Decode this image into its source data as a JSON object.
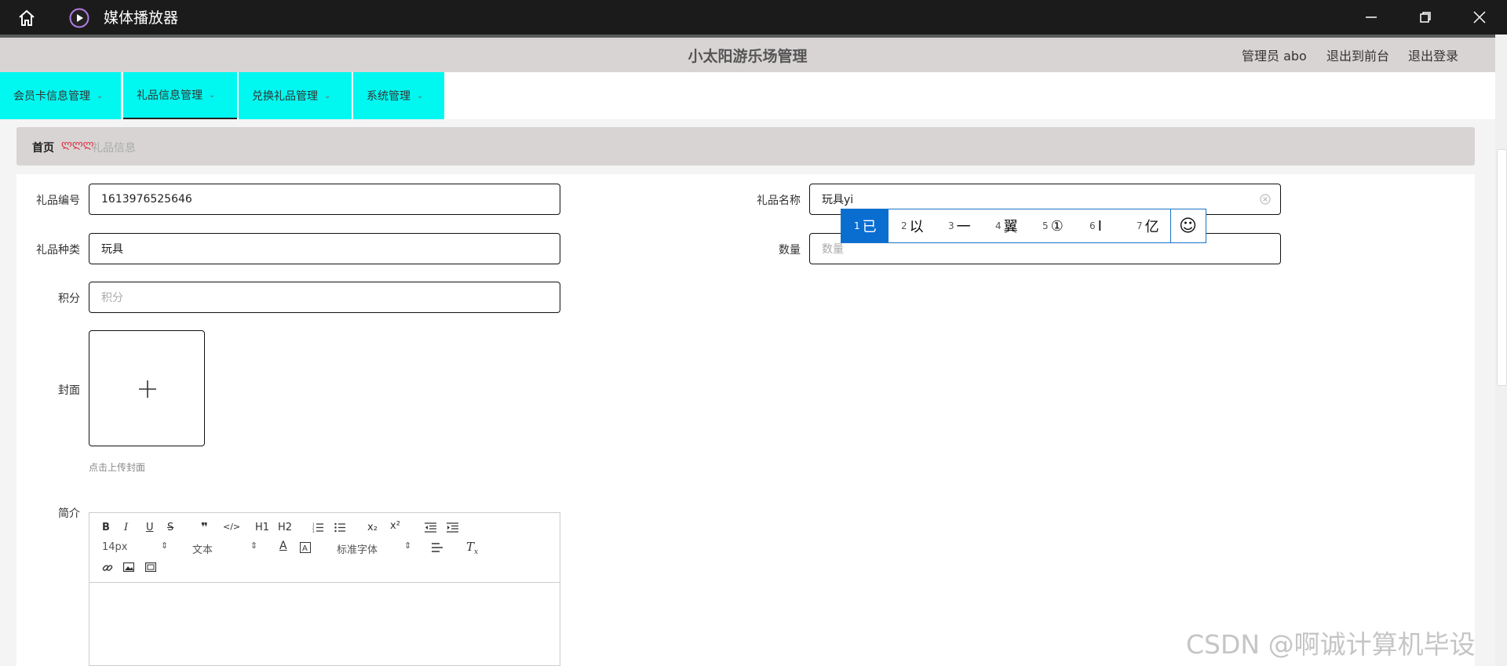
{
  "window": {
    "title": "媒体播放器",
    "controls": [
      "minimize-icon",
      "restore-icon",
      "close-icon"
    ]
  },
  "header": {
    "title": "小太阳游乐场管理",
    "admin": "管理员 abo",
    "to_frontend": "退出到前台",
    "logout": "退出登录"
  },
  "nav": {
    "items": [
      {
        "label": "会员卡信息管理"
      },
      {
        "label": "礼品信息管理"
      },
      {
        "label": "兑换礼品管理"
      },
      {
        "label": "系统管理"
      }
    ],
    "chevron": "⌄"
  },
  "breadcrumb": {
    "home": "首页",
    "separator": "ლლლ",
    "current": "礼品信息"
  },
  "form": {
    "gift_no_label": "礼品编号",
    "gift_no_value": "1613976525646",
    "gift_name_label": "礼品名称",
    "gift_name_value": "玩具yi",
    "gift_type_label": "礼品种类",
    "gift_type_value": "玩具",
    "quantity_label": "数量",
    "quantity_placeholder": "数量",
    "points_label": "积分",
    "points_placeholder": "积分",
    "cover_label": "封面",
    "cover_hint": "点击上传封面",
    "intro_label": "简介"
  },
  "ime": {
    "candidates": [
      {
        "n": "1",
        "text": "已"
      },
      {
        "n": "2",
        "text": "以"
      },
      {
        "n": "3",
        "text": "一"
      },
      {
        "n": "4",
        "text": "翼"
      },
      {
        "n": "5",
        "text": "①"
      },
      {
        "n": "6",
        "text": "Ⅰ"
      },
      {
        "n": "7",
        "text": "亿"
      }
    ],
    "emoji": "☺"
  },
  "editor": {
    "font_size": "14px",
    "block_type": "文本",
    "font_family": "标准字体",
    "buttons_row1": [
      "B",
      "I",
      "U",
      "S",
      "❞",
      "</>",
      "H1",
      "H2",
      "ol",
      "ul",
      "x₂",
      "x²",
      "outdent",
      "indent"
    ]
  },
  "watermark": "CSDN @啊诚计算机毕设"
}
